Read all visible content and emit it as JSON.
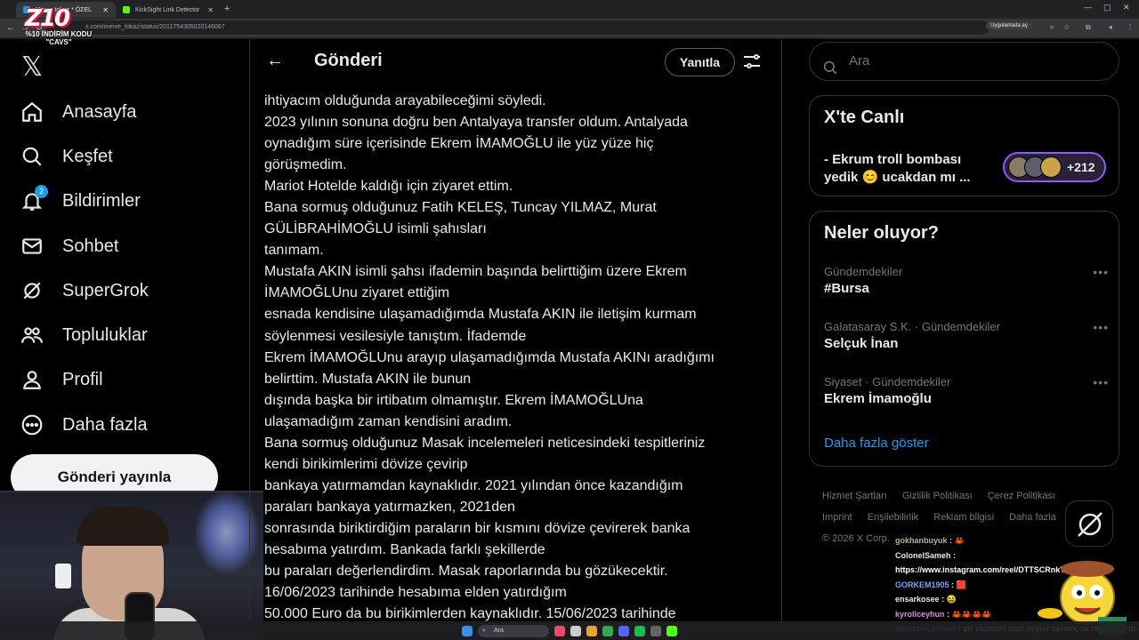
{
  "browser": {
    "tabs": [
      {
        "label": "Merve tokaz * ÖZEL"
      },
      {
        "label": "KickSight Link Detector"
      }
    ],
    "url": "x.com/merve_tokaz/status/2011754305020146067",
    "app_chip": "Uygulamada aç"
  },
  "overlay": {
    "logo_text": "Z10",
    "promo_line1": "%10 İNDİRİM KODU",
    "promo_line2": "\"CAVS\""
  },
  "nav": {
    "items": [
      {
        "label": "Anasayfa",
        "icon": "home-icon"
      },
      {
        "label": "Keşfet",
        "icon": "search-icon"
      },
      {
        "label": "Bildirimler",
        "icon": "bell-icon",
        "badge": "2"
      },
      {
        "label": "Sohbet",
        "icon": "mail-icon"
      },
      {
        "label": "SuperGrok",
        "icon": "grok-icon"
      },
      {
        "label": "Topluluklar",
        "icon": "communities-icon"
      },
      {
        "label": "Profil",
        "icon": "profile-icon"
      },
      {
        "label": "Daha fazla",
        "icon": "more-icon"
      }
    ],
    "post_button": "Gönderi yayınla"
  },
  "main": {
    "title": "Gönderi",
    "reply_button": "Yanıtla",
    "lines": [
      "ihtiyacım olduğunda arayabileceğimi söyledi.",
      "2023 yılının sonuna doğru ben Antalyaya transfer oldum. Antalyada",
      "oynadığım süre içerisinde Ekrem İMAMOĞLU ile yüz yüze hiç",
      "görüşmedim.",
      "Mariot Hotelde kaldığı için ziyaret ettim.",
      "Bana sormuş olduğunuz Fatih KELEŞ, Tuncay YILMAZ, Murat",
      "GÜLİBRAHİMOĞLU isimli şahısları",
      "tanımam.",
      "Mustafa AKIN isimli şahsı ifademin başında belirttiğim üzere Ekrem",
      "İMAMOĞLUnu ziyaret ettiğim",
      "esnada kendisine ulaşamadığımda Mustafa AKIN ile iletişim kurmam",
      "söylenmesi vesilesiyle tanıştım. İfademde",
      "Ekrem İMAMOĞLUnu arayıp ulaşamadığımda Mustafa AKINı aradığımı",
      "belirttim. Mustafa AKIN ile bunun",
      "dışında başka bir irtibatım olmamıştır. Ekrem İMAMOĞLUna",
      "ulaşamadığım zaman kendisini aradım.",
      "Bana sormuş olduğunuz Masak incelemeleri neticesindeki tespitleriniz",
      "kendi birikimlerimi dövize çevirip",
      "bankaya yatırmamdan kaynaklıdır. 2021 yılından önce kazandığım",
      "paraları bankaya yatırmazken, 2021den",
      "sonrasında biriktirdiğim paraların bir kısmını dövize çevirerek banka",
      "hesabıma yatırdım. Bankada farklı şekillerde",
      "bu paraları değerlendirdim. Masak raporlarında bu gözükecektir.",
      "16/06/2023 tarihinde hesabıma elden yatırdığım",
      "50.000 Euro da bu birikimlerden kaynaklıdır. 15/06/2023 tarihinde"
    ]
  },
  "right": {
    "search_placeholder": "Ara",
    "live": {
      "title": "X'te Canlı",
      "text": "- Ekrum troll bombası yedik 😊 ucakdan mı ...",
      "count": "+212"
    },
    "trends": {
      "title": "Neler oluyor?",
      "items": [
        {
          "meta": "Gündemdekiler",
          "name": "#Bursa"
        },
        {
          "meta": "Galatasaray S.K. · Gündemdekiler",
          "name": "Selçuk İnan"
        },
        {
          "meta": "Siyaset · Gündemdekiler",
          "name": "Ekrem İmamoğlu"
        }
      ],
      "show_more": "Daha fazla göster"
    },
    "footer": {
      "links": [
        "Hizmet Şartları",
        "Gizlilik Politikası",
        "Çerez Politikası",
        "Imprint",
        "Erişilebilirlik",
        "Reklam bilgisi",
        "Daha fazla"
      ],
      "copyright": "© 2026 X Corp."
    }
  },
  "chat": [
    {
      "user": "gokhanbuyuk",
      "msg": ": 🦀"
    },
    {
      "user": "ColonelSameh",
      "msg": ":"
    },
    {
      "user": "",
      "msg": "https://www.instagram.com/reel/DTTSCRnkT..."
    },
    {
      "user": "GORKEM1905",
      "msg": ": 🟥"
    },
    {
      "user": "ensarkosee",
      "msg": ": 😆"
    },
    {
      "user": "kyrollceyhun",
      "msg": ": 🦀🦀🦀🦀"
    },
    {
      "user": "SinopluKamyon",
      "msg": ": şu yazıdaki bazı şeyler benimçok rahatsız etti"
    }
  ],
  "taskbar": {
    "search_label": "Ara"
  }
}
